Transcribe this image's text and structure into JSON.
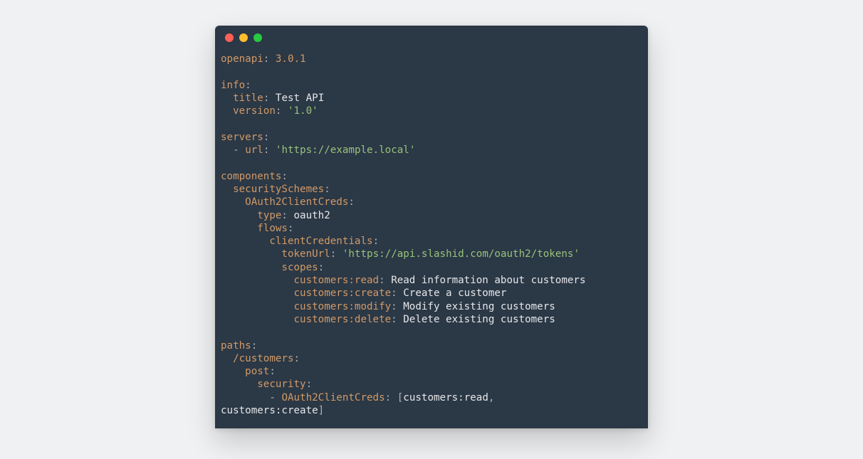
{
  "yaml": {
    "openapi_key": "openapi",
    "openapi_value": "3.0.1",
    "info_key": "info",
    "title_key": "title",
    "title_value": "Test API",
    "version_key": "version",
    "version_value": "'1.0'",
    "servers_key": "servers",
    "url_key": "url",
    "url_value": "'https://example.local'",
    "components_key": "components",
    "securitySchemes_key": "securitySchemes",
    "oauth2_key": "OAuth2ClientCreds",
    "type_key": "type",
    "type_value": "oauth2",
    "flows_key": "flows",
    "clientCredentials_key": "clientCredentials",
    "tokenUrl_key": "tokenUrl",
    "tokenUrl_value": "'https://api.slashid.com/oauth2/tokens'",
    "scopes_key": "scopes",
    "scope1_key": "customers:read",
    "scope1_value": "Read information about customers",
    "scope2_key": "customers:create",
    "scope2_value": "Create a customer",
    "scope3_key": "customers:modify",
    "scope3_value": "Modify existing customers",
    "scope4_key": "customers:delete",
    "scope4_value": "Delete existing customers",
    "paths_key": "paths",
    "customers_path_key": "/customers",
    "post_key": "post",
    "security_key": "security",
    "security_ref_key": "OAuth2ClientCreds",
    "security_item1": "customers:read",
    "security_item2": "customers:create"
  },
  "punct": {
    "colon": ":",
    "colon_sp": ": ",
    "dash": "- ",
    "lbracket": "[",
    "rbracket": "]",
    "comma": ","
  }
}
